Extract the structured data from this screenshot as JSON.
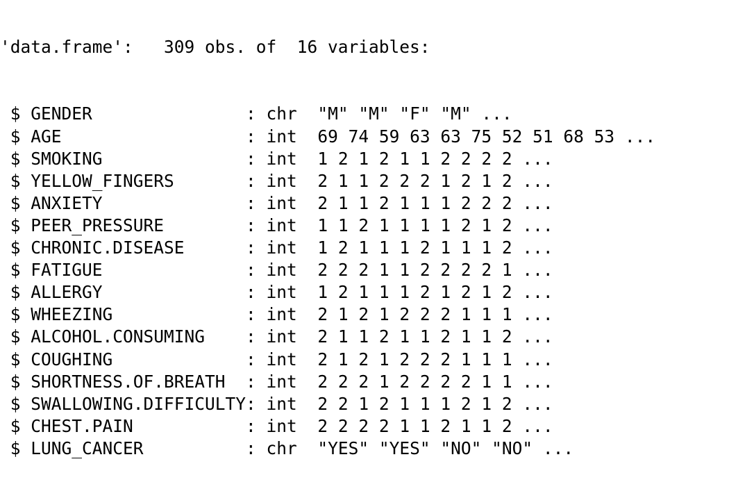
{
  "console": {
    "header": "'data.frame':\t309 obs. of  16 variables:",
    "rows": [
      {
        "prefix": " $ ",
        "name": "GENDER               ",
        "sep": ": ",
        "type": "chr",
        "values": "  \"M\" \"M\" \"F\" \"M\" ..."
      },
      {
        "prefix": " $ ",
        "name": "AGE                  ",
        "sep": ": ",
        "type": "int",
        "values": "  69 74 59 63 63 75 52 51 68 53 ..."
      },
      {
        "prefix": " $ ",
        "name": "SMOKING              ",
        "sep": ": ",
        "type": "int",
        "values": "  1 2 1 2 1 1 2 2 2 2 ..."
      },
      {
        "prefix": " $ ",
        "name": "YELLOW_FINGERS       ",
        "sep": ": ",
        "type": "int",
        "values": "  2 1 1 2 2 2 1 2 1 2 ..."
      },
      {
        "prefix": " $ ",
        "name": "ANXIETY              ",
        "sep": ": ",
        "type": "int",
        "values": "  2 1 1 2 1 1 1 2 2 2 ..."
      },
      {
        "prefix": " $ ",
        "name": "PEER_PRESSURE        ",
        "sep": ": ",
        "type": "int",
        "values": "  1 1 2 1 1 1 1 2 1 2 ..."
      },
      {
        "prefix": " $ ",
        "name": "CHRONIC.DISEASE      ",
        "sep": ": ",
        "type": "int",
        "values": "  1 2 1 1 1 2 1 1 1 2 ..."
      },
      {
        "prefix": " $ ",
        "name": "FATIGUE              ",
        "sep": ": ",
        "type": "int",
        "values": "  2 2 2 1 1 2 2 2 2 1 ..."
      },
      {
        "prefix": " $ ",
        "name": "ALLERGY              ",
        "sep": ": ",
        "type": "int",
        "values": "  1 2 1 1 1 2 1 2 1 2 ..."
      },
      {
        "prefix": " $ ",
        "name": "WHEEZING             ",
        "sep": ": ",
        "type": "int",
        "values": "  2 1 2 1 2 2 2 1 1 1 ..."
      },
      {
        "prefix": " $ ",
        "name": "ALCOHOL.CONSUMING    ",
        "sep": ": ",
        "type": "int",
        "values": "  2 1 1 2 1 1 2 1 1 2 ..."
      },
      {
        "prefix": " $ ",
        "name": "COUGHING             ",
        "sep": ": ",
        "type": "int",
        "values": "  2 1 2 1 2 2 2 1 1 1 ..."
      },
      {
        "prefix": " $ ",
        "name": "SHORTNESS.OF.BREATH  ",
        "sep": ": ",
        "type": "int",
        "values": "  2 2 2 1 2 2 2 2 1 1 ..."
      },
      {
        "prefix": " $ ",
        "name": "SWALLOWING.DIFFICULTY",
        "sep": ": ",
        "type": "int",
        "values": "  2 2 1 2 1 1 1 2 1 2 ..."
      },
      {
        "prefix": " $ ",
        "name": "CHEST.PAIN           ",
        "sep": ": ",
        "type": "int",
        "values": "  2 2 2 2 1 1 2 1 1 2 ..."
      },
      {
        "prefix": " $ ",
        "name": "LUNG_CANCER          ",
        "sep": ": ",
        "type": "chr",
        "values": "  \"YES\" \"YES\" \"NO\" \"NO\" ..."
      }
    ]
  }
}
